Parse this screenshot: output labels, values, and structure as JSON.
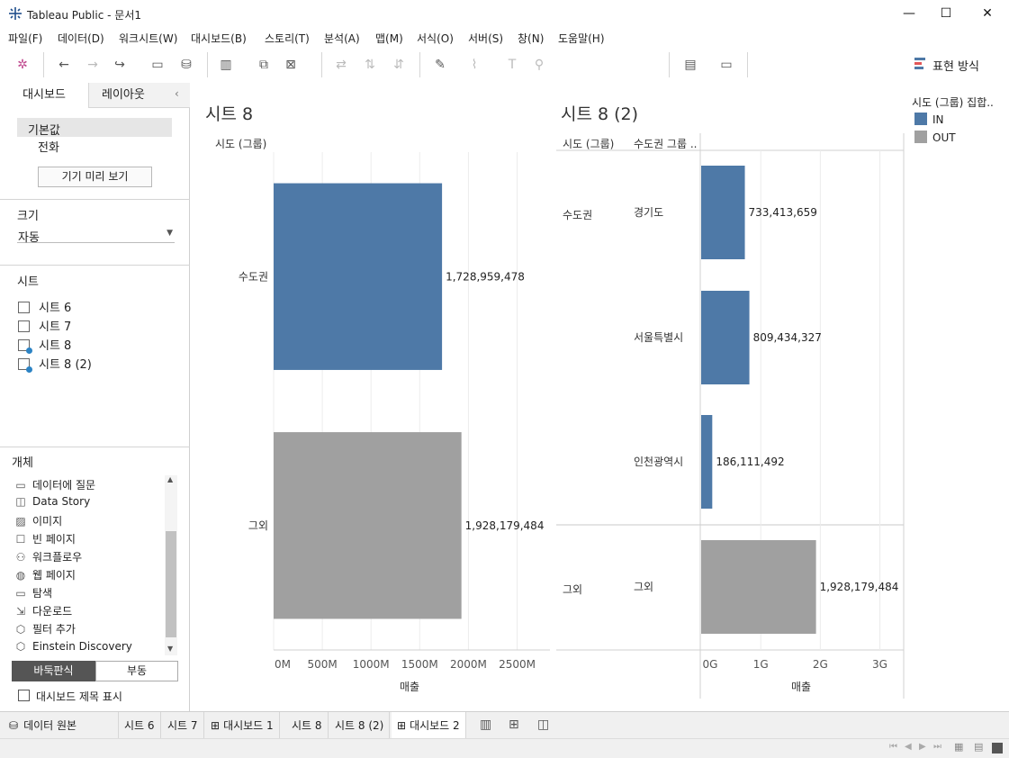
{
  "window": {
    "title": "Tableau Public - 문서1",
    "minimize": "—",
    "maximize": "☐",
    "close": "✕"
  },
  "menu": [
    "파일(F)",
    "데이터(D)",
    "워크시트(W)",
    "대시보드(B)",
    "스토리(T)",
    "분석(A)",
    "맵(M)",
    "서식(O)",
    "서버(S)",
    "창(N)",
    "도움말(H)"
  ],
  "toolbar": {
    "show_me_label": "표현 방식"
  },
  "left_panel": {
    "tabs": [
      "대시보드",
      "레이아웃"
    ],
    "device_default": "기본값",
    "device_phone": "전화",
    "preview_button": "기기 미리 보기",
    "size_title": "크기",
    "size_value": "자동",
    "sheets_title": "시트",
    "sheets": [
      "시트 6",
      "시트 7",
      "시트 8",
      "시트 8 (2)"
    ],
    "objects_title": "개체",
    "objects": [
      "데이터에 질문",
      "Data Story",
      "이미지",
      "빈 페이지",
      "워크플로우",
      "웹 페이지",
      "탐색",
      "다운로드",
      "필터 추가",
      "Einstein Discovery"
    ],
    "layout_tiled": "바둑판식",
    "layout_floating": "부동",
    "show_title_label": "대시보드 제목 표시"
  },
  "legend": {
    "title": "시도 (그룹) 집합..",
    "items": [
      {
        "label": "IN",
        "color": "#4e79a7"
      },
      {
        "label": "OUT",
        "color": "#a0a0a0"
      }
    ]
  },
  "chart_data": [
    {
      "type": "bar",
      "title": "시트 8",
      "row_header": "시도 (그룹)",
      "categories": [
        "수도권",
        "그외"
      ],
      "values": [
        1728959478,
        1928179484
      ],
      "value_labels": [
        "1,728,959,478",
        "1,928,179,484"
      ],
      "colors": [
        "#4e79a7",
        "#a0a0a0"
      ],
      "xlabel": "매출",
      "xlim": [
        0,
        2800000000
      ],
      "xticks": [
        {
          "value": 0,
          "label": "0M"
        },
        {
          "value": 500000000,
          "label": "500M"
        },
        {
          "value": 1000000000,
          "label": "1000M"
        },
        {
          "value": 1500000000,
          "label": "1500M"
        },
        {
          "value": 2000000000,
          "label": "2000M"
        },
        {
          "value": 2500000000,
          "label": "2500M"
        }
      ]
    },
    {
      "type": "bar",
      "title": "시트 8 (2)",
      "row_headers": [
        "시도 (그룹)",
        "수도권 그룹 .."
      ],
      "groups": [
        "수도권",
        "그외"
      ],
      "categories": [
        "경기도",
        "서울특별시",
        "인천광역시",
        "그외"
      ],
      "values": [
        733413659,
        809434327,
        186111492,
        1928179484
      ],
      "value_labels": [
        "733,413,659",
        "809,434,327",
        "186,111,492",
        "1,928,179,484"
      ],
      "colors": [
        "#4e79a7",
        "#4e79a7",
        "#4e79a7",
        "#a0a0a0"
      ],
      "xlabel": "매출",
      "xlim": [
        0,
        3400000000
      ],
      "xticks": [
        {
          "value": 0,
          "label": "0G"
        },
        {
          "value": 1000000000,
          "label": "1G"
        },
        {
          "value": 2000000000,
          "label": "2G"
        },
        {
          "value": 3000000000,
          "label": "3G"
        }
      ]
    }
  ],
  "bottom_tabs": [
    "데이터 원본",
    "시트 6",
    "시트 7",
    "대시보드 1",
    "시트 8",
    "시트 8 (2)",
    "대시보드 2"
  ]
}
